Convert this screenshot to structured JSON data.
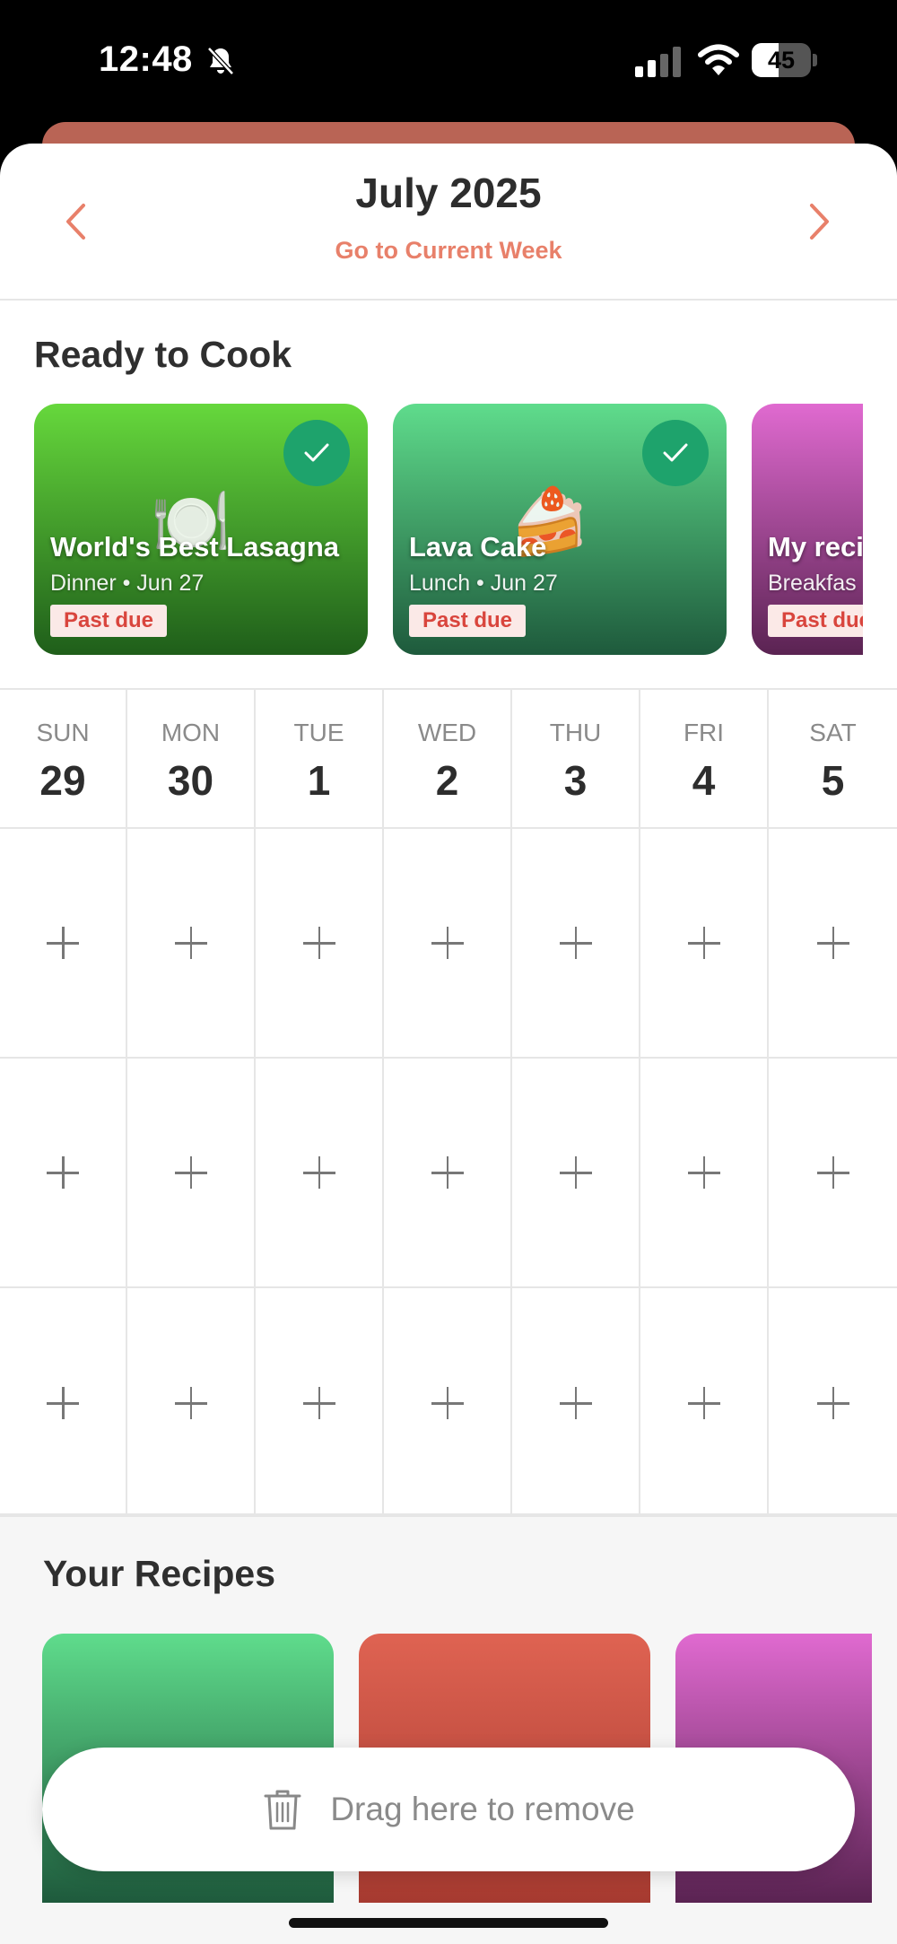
{
  "status_bar": {
    "time": "12:48",
    "battery_level": "45",
    "battery_fraction": 0.45,
    "icons": [
      "bell-slash-icon",
      "signal-icon",
      "wifi-icon",
      "battery-icon"
    ]
  },
  "header": {
    "title": "July 2025",
    "current_week_link": "Go to Current Week",
    "prev_icon": "chevron-left-icon",
    "next_icon": "chevron-right-icon",
    "accent_color": "#e8806a"
  },
  "ready_to_cook": {
    "title": "Ready to Cook",
    "cards": [
      {
        "name": "World's Best Lasagna",
        "meal": "Dinner",
        "date": "Jun 27",
        "meta": "Dinner • Jun 27",
        "badge": "Past due",
        "icon": "🍽️",
        "checked": true,
        "gradient": [
          "#66d83c",
          "#1f5e1a"
        ]
      },
      {
        "name": "Lava Cake",
        "meal": "Lunch",
        "date": "Jun 27",
        "meta": "Lunch • Jun 27",
        "badge": "Past due",
        "icon": "🍰",
        "checked": true,
        "gradient": [
          "#5fdc8c",
          "#1e5a3c"
        ]
      },
      {
        "name": "My reci",
        "meal": "Breakfas",
        "date": "",
        "meta": "Breakfas",
        "badge": "Past due",
        "icon": "",
        "checked": false,
        "gradient": [
          "#e06ad0",
          "#5a2352"
        ]
      }
    ]
  },
  "calendar": {
    "days": [
      {
        "name": "SUN",
        "num": "29"
      },
      {
        "name": "MON",
        "num": "30"
      },
      {
        "name": "TUE",
        "num": "1"
      },
      {
        "name": "WED",
        "num": "2"
      },
      {
        "name": "THU",
        "num": "3"
      },
      {
        "name": "FRI",
        "num": "4"
      },
      {
        "name": "SAT",
        "num": "5"
      }
    ],
    "slot_rows": 3,
    "slot_icon": "plus-icon"
  },
  "your_recipes": {
    "title": "Your Recipes",
    "tiles": [
      {
        "gradient": [
          "#5fdc8c",
          "#1e5a3c"
        ]
      },
      {
        "gradient": [
          "#df6352",
          "#a63a30"
        ]
      },
      {
        "gradient": [
          "#e06ad0",
          "#5a2352"
        ]
      }
    ]
  },
  "remove_bar": {
    "label": "Drag here to remove",
    "icon": "trash-icon"
  }
}
